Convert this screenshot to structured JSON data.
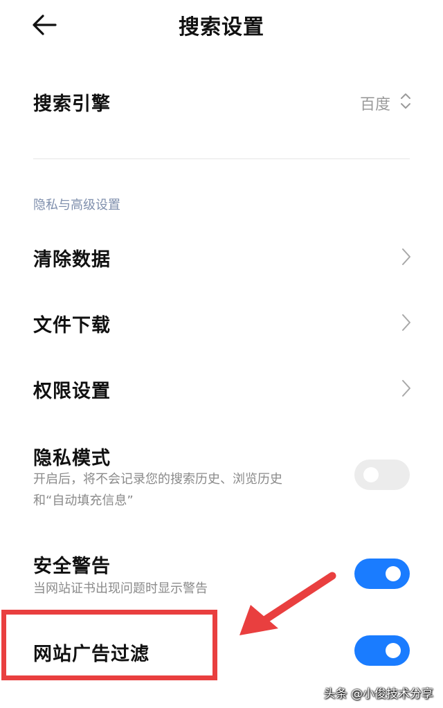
{
  "header": {
    "title": "搜索设置",
    "back_icon": "arrow-left-icon"
  },
  "search_engine": {
    "label": "搜索引擎",
    "value": "百度",
    "icon": "up-down-chevron-icon"
  },
  "section_privacy": {
    "label": "隐私与高级设置"
  },
  "rows": {
    "clear_data": {
      "label": "清除数据",
      "icon": "chevron-right-icon"
    },
    "file_download": {
      "label": "文件下载",
      "icon": "chevron-right-icon"
    },
    "permissions": {
      "label": "权限设置",
      "icon": "chevron-right-icon"
    }
  },
  "privacy_mode": {
    "label": "隐私模式",
    "desc_line1": "开启后，将不会记录您的搜索历史、浏览历史",
    "desc_line2": "和“自动填充信息”",
    "enabled": false
  },
  "security_warning": {
    "label": "安全警告",
    "desc": "当网站证书出现问题时显示警告",
    "enabled": true
  },
  "ad_filter": {
    "label": "网站广告过滤",
    "enabled": true
  },
  "annotation": {
    "highlight_color": "#e93f3f"
  },
  "accent_color": "#1a7cff",
  "watermark": {
    "text": "头条 @小俊技术分享"
  }
}
